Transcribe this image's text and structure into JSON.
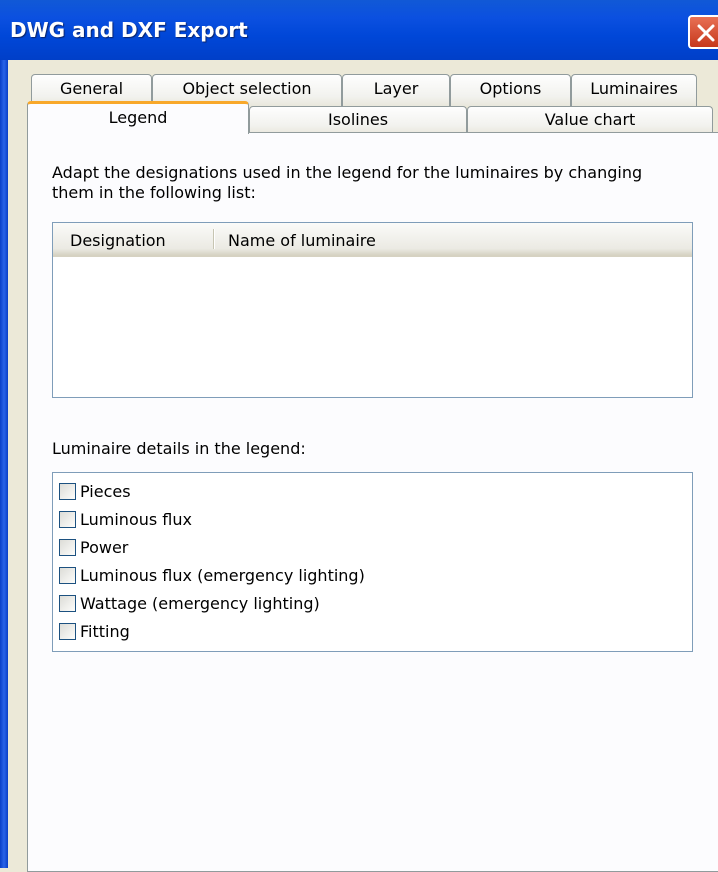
{
  "window": {
    "title": "DWG and DXF Export"
  },
  "tabs_row1": [
    "General",
    "Object selection",
    "Layer",
    "Options",
    "Luminaires"
  ],
  "tabs_row2": [
    "Legend",
    "Isolines",
    "Value chart"
  ],
  "active_tab": "Legend",
  "legend": {
    "instruction_line1": "Adapt the designations used in the legend for the luminaires by changing",
    "instruction_line2": "them in the following list:",
    "columns": [
      "Designation",
      "Name of luminaire"
    ],
    "details_label": "Luminaire details in the legend:",
    "details": [
      {
        "label": "Pieces",
        "checked": false
      },
      {
        "label": "Luminous flux",
        "checked": false
      },
      {
        "label": "Power",
        "checked": false
      },
      {
        "label": "Luminous flux (emergency lighting)",
        "checked": false
      },
      {
        "label": "Wattage (emergency lighting)",
        "checked": false
      },
      {
        "label": "Fitting",
        "checked": false
      }
    ]
  },
  "colors": {
    "titlebar": "#0047d8",
    "active_tab_accent": "#f8a82a",
    "dialog_bg": "#ece9d8"
  }
}
